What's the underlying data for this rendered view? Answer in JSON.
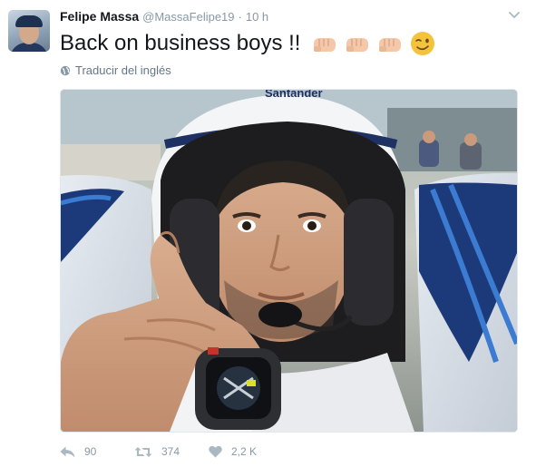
{
  "tweet": {
    "author": {
      "name": "Felipe Massa",
      "handle": "@MassaFelipe19",
      "separator": "·",
      "time": "10 h"
    },
    "text": "Back on business boys !!",
    "emojis": [
      "fist-bump",
      "fist-bump",
      "fist-bump",
      "winking-face"
    ],
    "translate_label": "Traducir del inglés",
    "actions": {
      "replies": "90",
      "retweets": "374",
      "likes": "2,2 K"
    }
  },
  "media": {
    "helmet_text": "Santander"
  },
  "colors": {
    "text": "#14171a",
    "muted": "#8899a6",
    "border": "#e1e8ed",
    "emoji_fist": "#f4c8a8",
    "emoji_wink": "#f5c33b"
  },
  "icons": [
    "more-caret-icon",
    "globe-icon",
    "reply-icon",
    "retweet-icon",
    "heart-icon"
  ]
}
